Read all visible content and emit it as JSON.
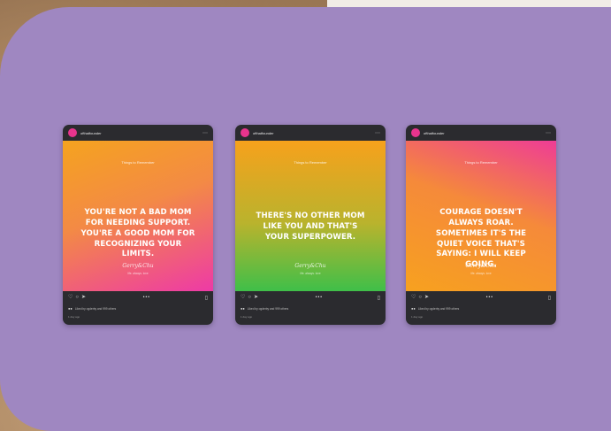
{
  "posts": [
    {
      "handle": "ofthatfounder",
      "eyebrow": "Things to Remember",
      "quote": "YOU'RE NOT A BAD MOM FOR NEEDING SUPPORT. YOU'RE A GOOD MOM FOR RECOGNIZING YOUR LIMITS.",
      "signature": "Gerry&Chu",
      "signature_sub": "life. always. love",
      "liked_by": "Liked by ogderby and 999 others",
      "time": "1 day ago",
      "gradient": [
        "#f5a31f",
        "#ee3aa6"
      ]
    },
    {
      "handle": "ofthatfounder",
      "eyebrow": "Things to Remember",
      "quote": "THERE'S NO OTHER MOM LIKE YOU AND THAT'S YOUR SUPERPOWER.",
      "signature": "Gerry&Chu",
      "signature_sub": "life. always. love",
      "liked_by": "Liked by ogderby and 999 others",
      "time": "1 day ago",
      "gradient": [
        "#f7a11c",
        "#3fbf49"
      ]
    },
    {
      "handle": "ofthatfounder",
      "eyebrow": "Things to Remember",
      "quote": "COURAGE DOESN'T ALWAYS ROAR. SOMETIMES IT'S THE QUIET VOICE THAT'S SAYING: I WILL KEEP GOING.",
      "signature": "Gerry&Chu",
      "signature_sub": "life. always. love",
      "liked_by": "Liked by ogderby and 999 others",
      "time": "1 day ago",
      "gradient": [
        "#ee3c96",
        "#f7a11f"
      ]
    }
  ],
  "icons": {
    "more": "more-icon",
    "like": "heart-icon",
    "comment": "comment-icon",
    "share": "share-icon",
    "save": "bookmark-icon"
  },
  "colors": {
    "panel": "#9f87c1",
    "card": "#2b2b2f"
  }
}
